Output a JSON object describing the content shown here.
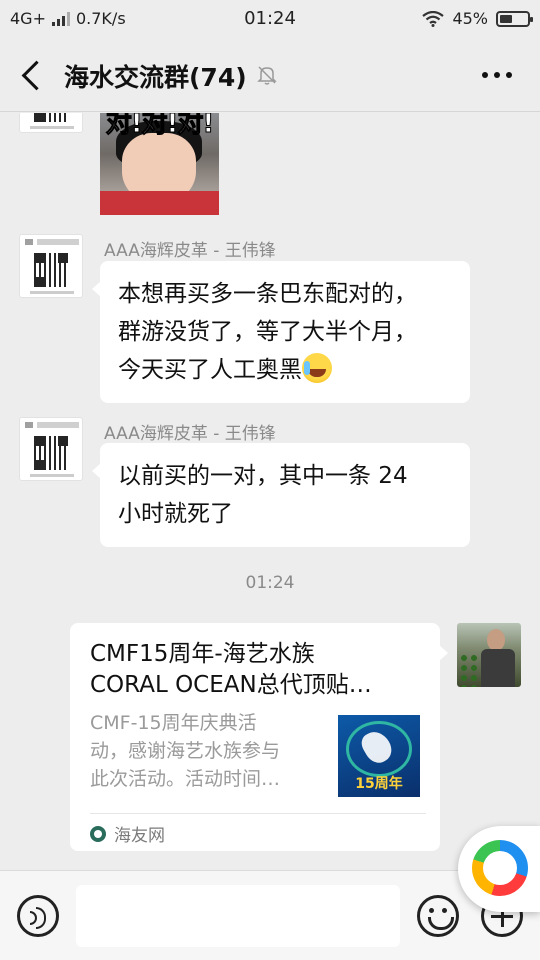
{
  "status_bar": {
    "network": "4G+",
    "speed": "0.7K/s",
    "time": "01:24",
    "battery": "45%",
    "battery_level": 0.45
  },
  "header": {
    "title": "海水交流群(74)"
  },
  "messages": [
    {
      "sender": "AAA海辉皮革 - 王伟锋",
      "lines": [
        "本想再买多一条巴东配对的，",
        "群游没货了，等了大半个月，",
        "今天买了人工奥黑"
      ]
    },
    {
      "sender": "AAA海辉皮革 - 王伟锋",
      "lines": [
        "以前买的一对，其中一条 24",
        "小时就死了"
      ]
    }
  ],
  "sticker_caption": "对!对!对!",
  "timestamp": "01:24",
  "card": {
    "title_lines": [
      "CMF15周年-海艺水族",
      "CORAL OCEAN总代顶贴…"
    ],
    "desc_lines": [
      "CMF-15周年庆典活",
      "动，感谢海艺水族参与",
      "此次活动。活动时间…"
    ],
    "thumb_text": "15周年",
    "source": "海友网"
  }
}
